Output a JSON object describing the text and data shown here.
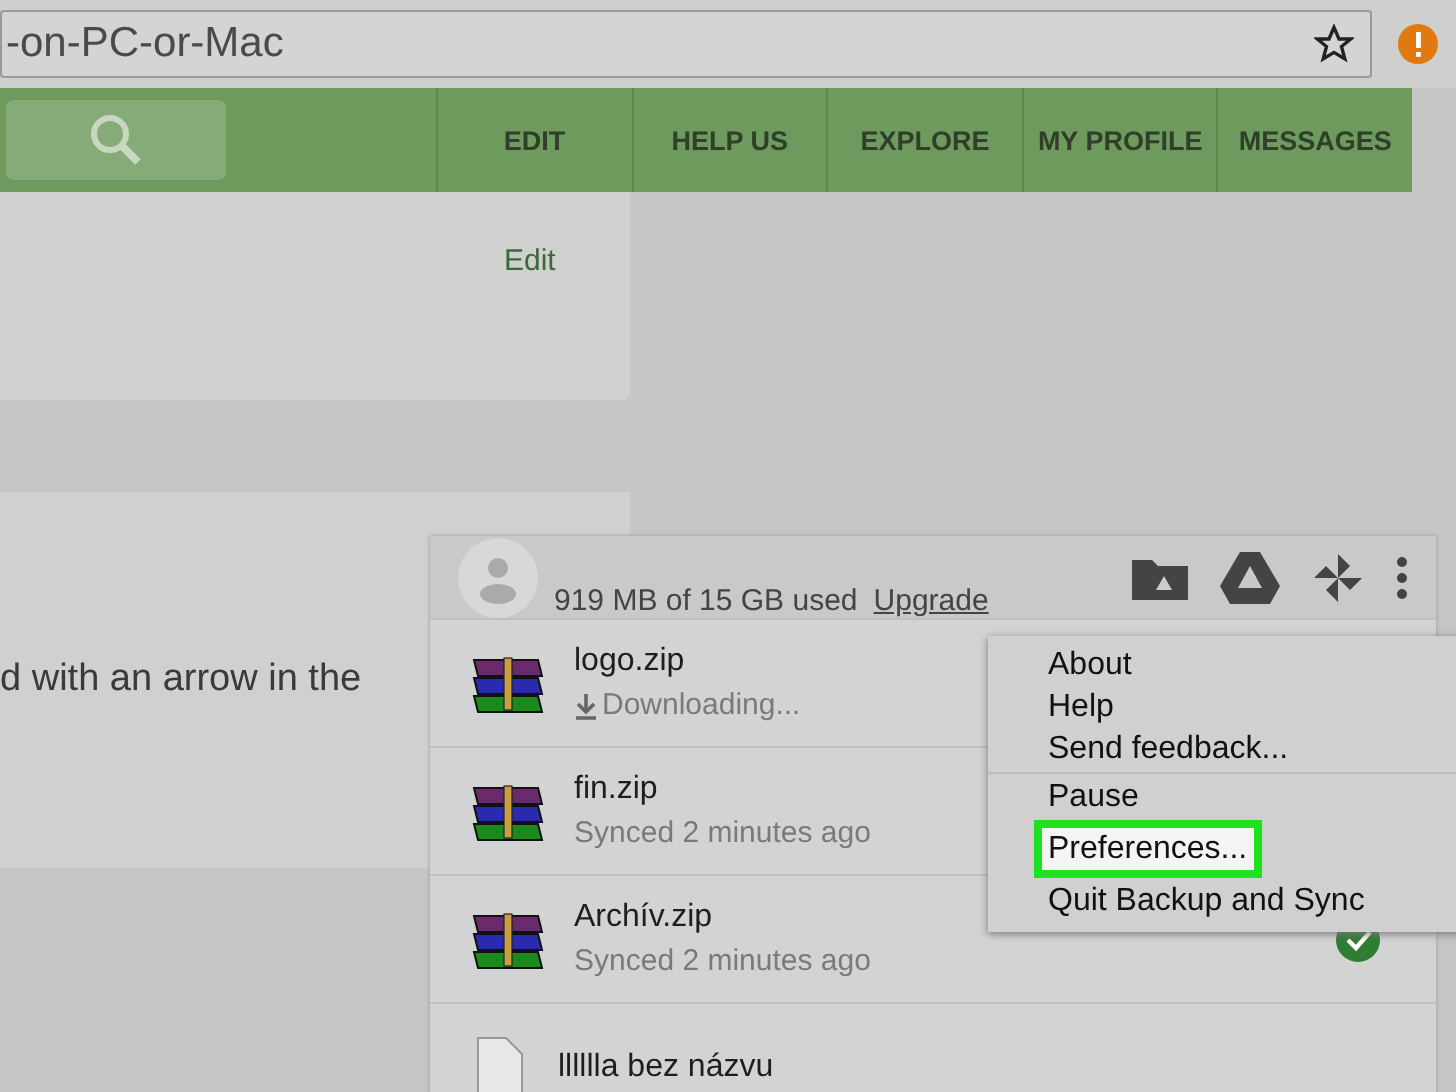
{
  "address_bar": {
    "url": "-on-PC-or-Mac"
  },
  "nav": {
    "items": [
      "EDIT",
      "HELP US",
      "EXPLORE",
      "MY PROFILE",
      "MESSAGES"
    ]
  },
  "page": {
    "edit_link": "Edit",
    "text": "d with an arrow in the"
  },
  "sync_panel": {
    "usage": "919 MB of 15 GB used",
    "upgrade": "Upgrade",
    "files": [
      {
        "name": "logo.zip",
        "status": "Downloading...",
        "kind": "downloading",
        "checked": false
      },
      {
        "name": "fin.zip",
        "status": "Synced 2 minutes ago",
        "kind": "synced",
        "checked": false
      },
      {
        "name": "Archív.zip",
        "status": "Synced 2 minutes ago",
        "kind": "synced",
        "checked": true
      },
      {
        "name": "lllllla bez názvu",
        "kind": "document",
        "checked": false
      }
    ]
  },
  "menu": {
    "sections": [
      [
        {
          "label": "About",
          "highlighted": false
        },
        {
          "label": "Help",
          "highlighted": false
        },
        {
          "label": "Send feedback...",
          "highlighted": false
        }
      ],
      [
        {
          "label": "Pause",
          "highlighted": false
        },
        {
          "label": "Preferences...",
          "highlighted": true
        },
        {
          "label": "Quit Backup and Sync",
          "highlighted": false
        }
      ]
    ]
  }
}
